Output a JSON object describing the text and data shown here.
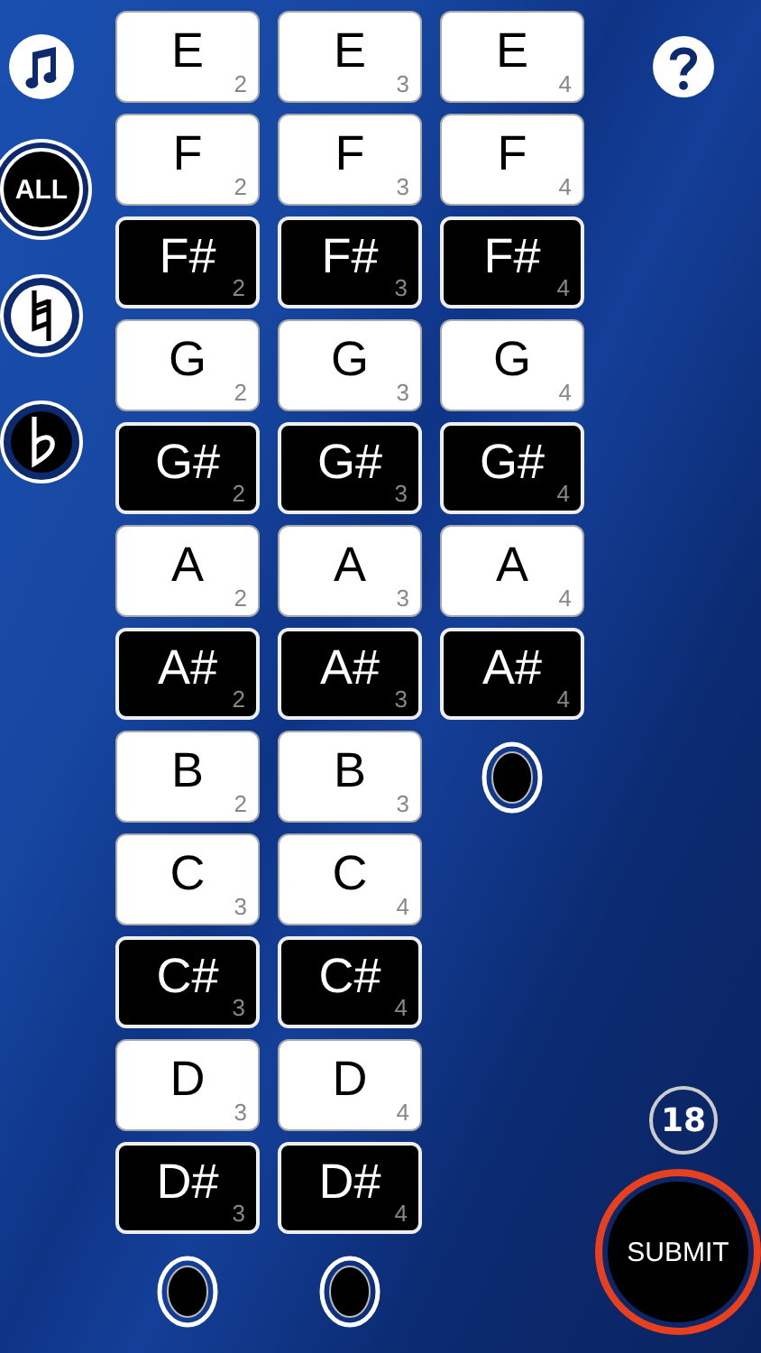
{
  "sidebar": {
    "all_button": "ALL"
  },
  "columns": [
    {
      "keys": [
        {
          "note": "E",
          "octave": "2",
          "kind": "white"
        },
        {
          "note": "F",
          "octave": "2",
          "kind": "white"
        },
        {
          "note": "F#",
          "octave": "2",
          "kind": "black"
        },
        {
          "note": "G",
          "octave": "2",
          "kind": "white"
        },
        {
          "note": "G#",
          "octave": "2",
          "kind": "black"
        },
        {
          "note": "A",
          "octave": "2",
          "kind": "white"
        },
        {
          "note": "A#",
          "octave": "2",
          "kind": "black"
        },
        {
          "note": "B",
          "octave": "2",
          "kind": "white"
        },
        {
          "note": "C",
          "octave": "3",
          "kind": "white"
        },
        {
          "note": "C#",
          "octave": "3",
          "kind": "black"
        },
        {
          "note": "D",
          "octave": "3",
          "kind": "white"
        },
        {
          "note": "D#",
          "octave": "3",
          "kind": "black"
        }
      ]
    },
    {
      "keys": [
        {
          "note": "E",
          "octave": "3",
          "kind": "white"
        },
        {
          "note": "F",
          "octave": "3",
          "kind": "white"
        },
        {
          "note": "F#",
          "octave": "3",
          "kind": "black"
        },
        {
          "note": "G",
          "octave": "3",
          "kind": "white"
        },
        {
          "note": "G#",
          "octave": "3",
          "kind": "black"
        },
        {
          "note": "A",
          "octave": "3",
          "kind": "white"
        },
        {
          "note": "A#",
          "octave": "3",
          "kind": "black"
        },
        {
          "note": "B",
          "octave": "3",
          "kind": "white"
        },
        {
          "note": "C",
          "octave": "4",
          "kind": "white"
        },
        {
          "note": "C#",
          "octave": "4",
          "kind": "black"
        },
        {
          "note": "D",
          "octave": "4",
          "kind": "white"
        },
        {
          "note": "D#",
          "octave": "4",
          "kind": "black"
        }
      ]
    },
    {
      "keys": [
        {
          "note": "E",
          "octave": "4",
          "kind": "white"
        },
        {
          "note": "F",
          "octave": "4",
          "kind": "white"
        },
        {
          "note": "F#",
          "octave": "4",
          "kind": "black"
        },
        {
          "note": "G",
          "octave": "4",
          "kind": "white"
        },
        {
          "note": "G#",
          "octave": "4",
          "kind": "black"
        },
        {
          "note": "A",
          "octave": "4",
          "kind": "white"
        },
        {
          "note": "A#",
          "octave": "4",
          "kind": "black"
        }
      ]
    }
  ],
  "counter": "18",
  "submit_button": "SUBMIT"
}
